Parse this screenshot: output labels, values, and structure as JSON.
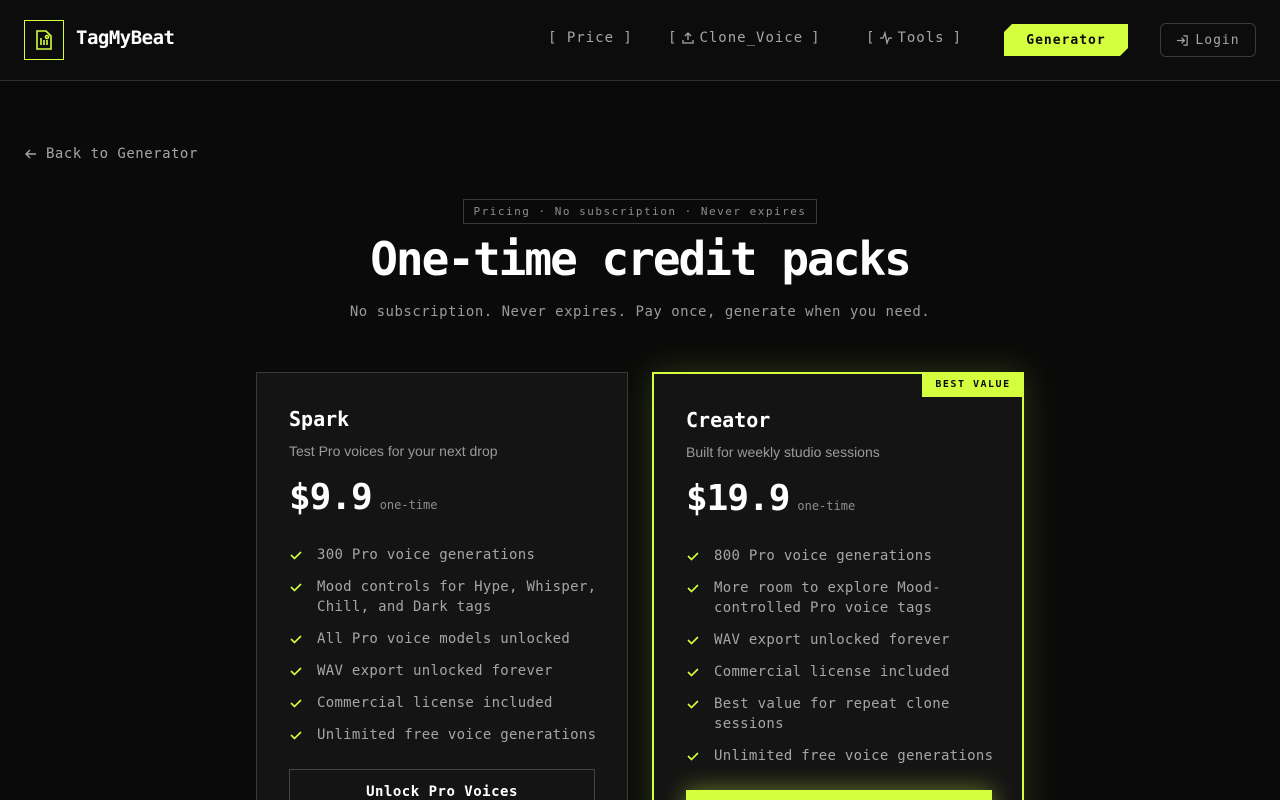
{
  "header": {
    "brand": "TagMyBeat",
    "nav": {
      "price": "[ Price ]",
      "clone_open": "[",
      "clone_label": "Clone_Voice",
      "clone_close": "]",
      "tools_open": "[",
      "tools_label": "Tools",
      "tools_close": "]"
    },
    "generator_label": "Generator",
    "login_label": "Login"
  },
  "back_link": "Back to Generator",
  "hero": {
    "eyebrow": "Pricing · No subscription · Never expires",
    "title": "One-time credit packs",
    "subtitle": "No subscription. Never expires. Pay once, generate when you need."
  },
  "plans": [
    {
      "name": "Spark",
      "description": "Test Pro voices for your next drop",
      "price": "$9.9",
      "price_note": "one-time",
      "features": [
        "300 Pro voice generations",
        "Mood controls for Hype, Whisper, Chill, and Dark tags",
        "All Pro voice models unlocked",
        "WAV export unlocked forever",
        "Commercial license included",
        "Unlimited free voice generations"
      ],
      "cta": "Unlock Pro Voices"
    },
    {
      "name": "Creator",
      "badge": "BEST VALUE",
      "description": "Built for weekly studio sessions",
      "price": "$19.9",
      "price_note": "one-time",
      "features": [
        "800 Pro voice generations",
        "More room to explore Mood-controlled Pro voice tags",
        "WAV export unlocked forever",
        "Commercial license included",
        "Best value for repeat clone sessions",
        "Unlimited free voice generations"
      ],
      "cta": ""
    }
  ],
  "colors": {
    "accent": "#d4ff3f",
    "background": "#0a0a0a",
    "card": "#141414"
  },
  "icons": {
    "logo": "waveform-file-icon",
    "clone": "upload-icon",
    "tools": "pulse-icon",
    "login": "login-arrow-icon",
    "back": "arrow-left-icon",
    "feature": "check-icon"
  }
}
